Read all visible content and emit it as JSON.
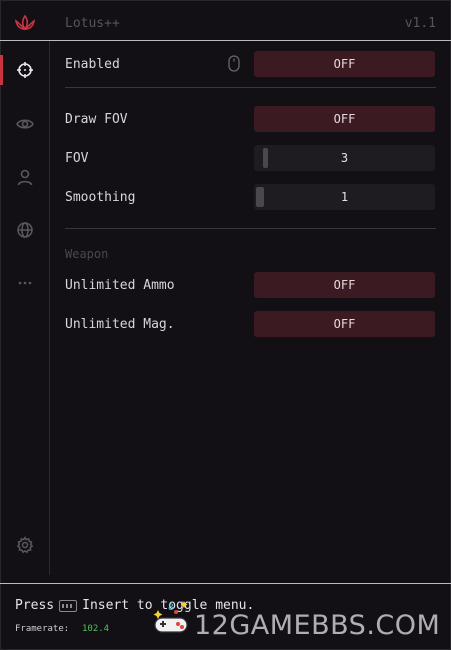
{
  "header": {
    "title": "Lotus++",
    "version": "v1.1"
  },
  "sidebar": {
    "items": [
      {
        "name": "aimbot",
        "icon": "crosshair-icon",
        "active": true
      },
      {
        "name": "visuals",
        "icon": "eye-icon",
        "active": false
      },
      {
        "name": "player",
        "icon": "user-icon",
        "active": false
      },
      {
        "name": "world",
        "icon": "globe-icon",
        "active": false
      },
      {
        "name": "misc",
        "icon": "more-dots-icon",
        "active": false
      }
    ],
    "settings_icon": "gear-icon"
  },
  "aim": {
    "enabled_label": "Enabled",
    "enabled_value": "OFF",
    "enabled_bind_icon": "mouse-icon",
    "draw_fov_label": "Draw FOV",
    "draw_fov_value": "OFF",
    "fov_label": "FOV",
    "fov_value": "3",
    "smoothing_label": "Smoothing",
    "smoothing_value": "1"
  },
  "weapon": {
    "section_title": "Weapon",
    "unlimited_ammo_label": "Unlimited Ammo",
    "unlimited_ammo_value": "OFF",
    "unlimited_mag_label": "Unlimited Mag.",
    "unlimited_mag_value": "OFF"
  },
  "footer": {
    "hint_prefix": "Press",
    "hint_key_icon": "keyboard-icon",
    "hint_suffix": "Insert to toggle menu.",
    "framerate_label": "Framerate:",
    "framerate_value": "102.4"
  },
  "watermark": {
    "text": "12GAMEBBS.COM"
  },
  "colors": {
    "accent": "#c8343f",
    "toggle_bg": "#3b1a22",
    "slider_bg": "#1e1c21",
    "framerate": "#4fc35a"
  }
}
